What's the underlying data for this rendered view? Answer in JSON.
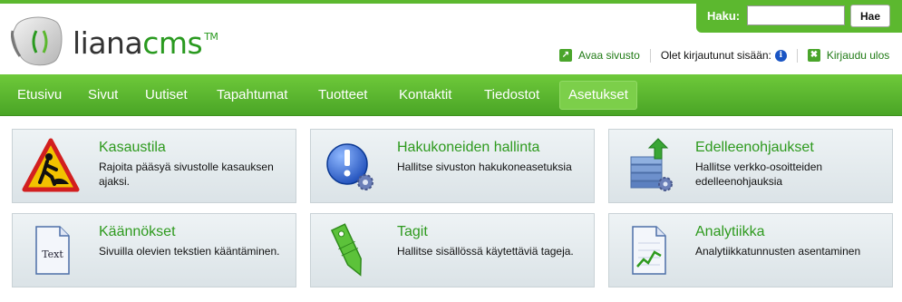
{
  "logo": {
    "name": "liana",
    "accent": "cms",
    "tm": "TM"
  },
  "search": {
    "label": "Haku:",
    "value": "",
    "button": "Hae"
  },
  "userbar": {
    "open_site": "Avaa sivusto",
    "status": "Olet kirjautunut sisään:",
    "info_glyph": "i",
    "logout": "Kirjaudu ulos"
  },
  "nav": {
    "items": [
      {
        "label": "Etusivu"
      },
      {
        "label": "Sivut"
      },
      {
        "label": "Uutiset"
      },
      {
        "label": "Tapahtumat"
      },
      {
        "label": "Tuotteet"
      },
      {
        "label": "Kontaktit"
      },
      {
        "label": "Tiedostot"
      },
      {
        "label": "Asetukset"
      }
    ],
    "active": "Asetukset"
  },
  "tiles": [
    {
      "title": "Kasaustila",
      "desc": "Rajoita pääsyä sivustolle kasauksen ajaksi.",
      "icon": "construction-sign-icon"
    },
    {
      "title": "Hakukoneiden hallinta",
      "desc": "Hallitse sivuston hakukoneasetuksia",
      "icon": "search-engine-settings-icon"
    },
    {
      "title": "Edelleenohjaukset",
      "desc": "Hallitse verkko-osoitteiden edelleenohjauksia",
      "icon": "redirect-server-icon"
    },
    {
      "title": "Käännökset",
      "desc": "Sivuilla olevien tekstien kääntäminen.",
      "icon": "text-document-icon",
      "icon_text": "Text"
    },
    {
      "title": "Tagit",
      "desc": "Hallitse sisällössä käytettäviä tageja.",
      "icon": "tag-icon"
    },
    {
      "title": "Analytiikka",
      "desc": "Analytiikkatunnusten asentaminen",
      "icon": "analytics-chart-icon"
    }
  ],
  "colors": {
    "brand_green": "#5cb82f",
    "link_green": "#2e9a1e",
    "tile_bg": "#e3eaed"
  }
}
